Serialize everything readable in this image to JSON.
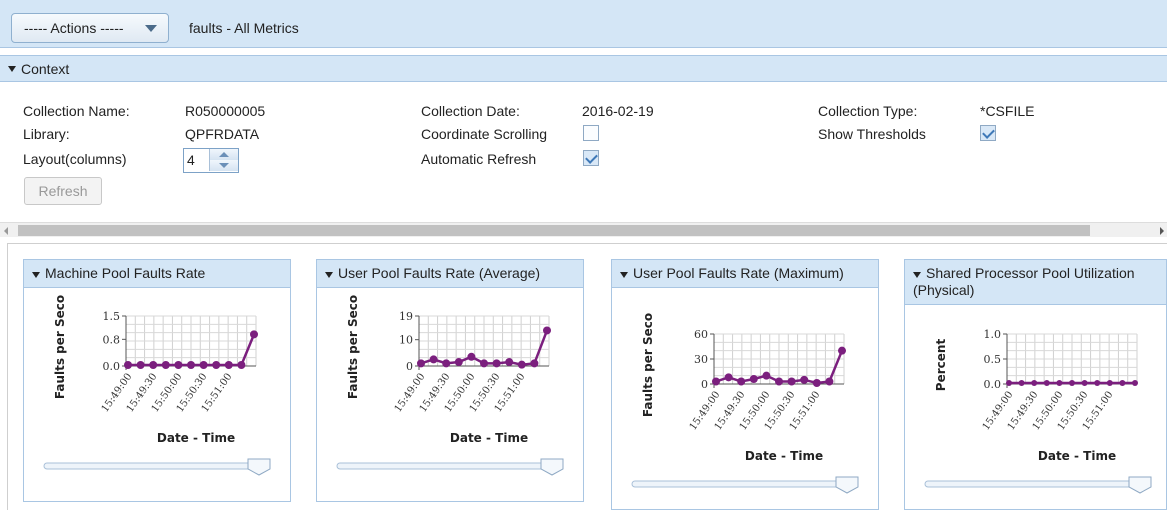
{
  "toolbar": {
    "actions_label": "----- Actions -----",
    "page_title": "faults - All Metrics"
  },
  "context": {
    "header": "Context",
    "collection_name_label": "Collection Name:",
    "collection_name": "R050000005",
    "library_label": "Library:",
    "library": "QPFRDATA",
    "layout_label": "Layout(columns)",
    "layout_value": "4",
    "collection_date_label": "Collection Date:",
    "collection_date": "2016-02-19",
    "coordinate_scrolling_label": "Coordinate Scrolling",
    "coordinate_scrolling": false,
    "automatic_refresh_label": "Automatic Refresh",
    "automatic_refresh": true,
    "collection_type_label": "Collection Type:",
    "collection_type": "*CSFILE",
    "show_thresholds_label": "Show Thresholds",
    "show_thresholds": true,
    "refresh_label": "Refresh"
  },
  "colors": {
    "header_bg": "#d4e6f6",
    "series": "#7b1f7e",
    "border": "#a9c6e3"
  },
  "chart_data": [
    {
      "type": "line",
      "title": "Machine Pool Faults Rate",
      "xlabel": "Date - Time",
      "ylabel": "Faults per Seco",
      "yticks": [
        "1.5",
        "0.8",
        "0.0"
      ],
      "ylim": [
        0,
        1.5
      ],
      "xticks": [
        "15:49:00",
        "15:49:30",
        "15:50:00",
        "15:50:30",
        "15:51:00"
      ],
      "values": [
        0.02,
        0.02,
        0.02,
        0.02,
        0.02,
        0.02,
        0.02,
        0.02,
        0.02,
        0.02,
        0.95
      ]
    },
    {
      "type": "line",
      "title": "User Pool Faults Rate (Average)",
      "xlabel": "Date - Time",
      "ylabel": "Faults per Seco",
      "yticks": [
        "19",
        "10",
        "0"
      ],
      "ylim": [
        0,
        19
      ],
      "xticks": [
        "15:49:00",
        "15:49:30",
        "15:50:00",
        "15:50:30",
        "15:51:00"
      ],
      "values": [
        1,
        2.5,
        1,
        1.5,
        3.5,
        1,
        1,
        1.5,
        0.5,
        1,
        13.5
      ]
    },
    {
      "type": "line",
      "title": "User Pool Faults Rate (Maximum)",
      "xlabel": "Date - Time",
      "ylabel": "Faults per Seco",
      "yticks": [
        "60",
        "30",
        "0"
      ],
      "ylim": [
        0,
        60
      ],
      "xticks": [
        "15:49:00",
        "15:49:30",
        "15:50:00",
        "15:50:30",
        "15:51:00"
      ],
      "values": [
        3,
        8,
        3,
        6,
        10,
        3,
        3,
        5,
        1,
        3,
        40
      ]
    },
    {
      "type": "line",
      "title": "Shared Processor Pool Utilization (Physical)",
      "xlabel": "Date - Time",
      "ylabel": "Percent",
      "yticks": [
        "1.0",
        "0.5",
        "0.0"
      ],
      "ylim": [
        0,
        1.0
      ],
      "xticks": [
        "15:49:00",
        "15:49:30",
        "15:50:00",
        "15:50:30",
        "15:51:00"
      ],
      "values": [
        0,
        0,
        0,
        0,
        0,
        0,
        0,
        0,
        0,
        0,
        0
      ]
    }
  ]
}
